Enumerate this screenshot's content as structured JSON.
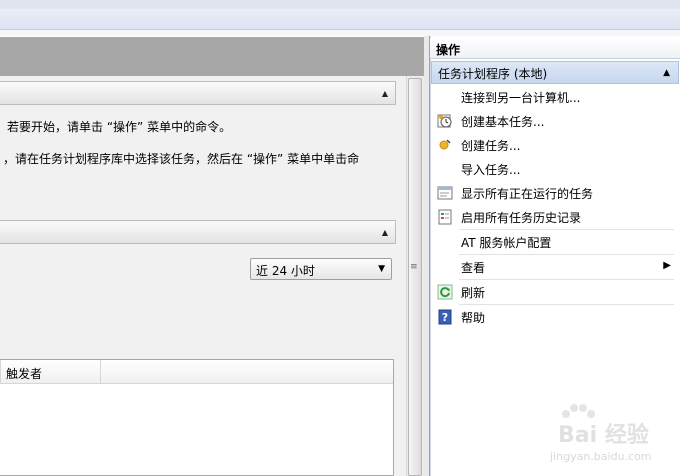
{
  "overview": {
    "line1": "若要开始，请单击 “操作” 菜单中的命令。",
    "line2": "，请在任务计划程序库中选择该任务，然后在 “操作” 菜单中单击命"
  },
  "status": {
    "range_value": "近 24 小时",
    "columns": [
      "触发者"
    ]
  },
  "actions": {
    "title": "操作",
    "group": "任务计划程序 (本地)",
    "items": [
      {
        "label": "连接到另一台计算机...",
        "icon": "none"
      },
      {
        "label": "创建基本任务...",
        "icon": "clock-wizard-icon"
      },
      {
        "label": "创建任务...",
        "icon": "task-create-icon"
      },
      {
        "label": "导入任务...",
        "icon": "none"
      },
      {
        "label": "显示所有正在运行的任务",
        "icon": "running-tasks-icon"
      },
      {
        "label": "启用所有任务历史记录",
        "icon": "history-log-icon"
      },
      {
        "label": "AT 服务帐户配置",
        "icon": "none"
      },
      {
        "label": "查看",
        "icon": "none",
        "submenu": true
      },
      {
        "label": "刷新",
        "icon": "refresh-icon"
      },
      {
        "label": "帮助",
        "icon": "help-icon"
      }
    ]
  },
  "watermark": {
    "brand": "Bai 经验",
    "url": "jingyan.baidu.com"
  },
  "colors": {
    "group_header": "#c6d7ee",
    "left_header": "#a7a7a7",
    "help_icon": "#3a5fb8",
    "refresh_icon": "#2f9a3a"
  }
}
